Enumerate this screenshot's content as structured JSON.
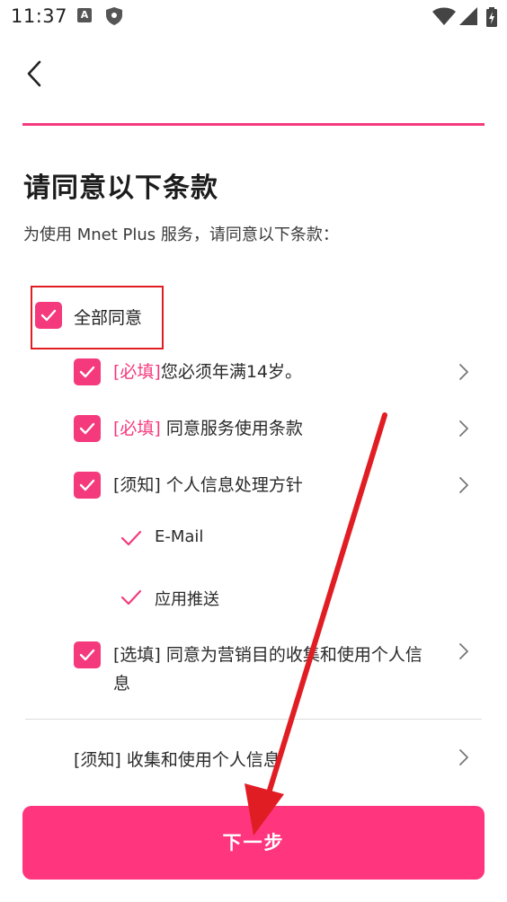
{
  "status_bar": {
    "time": "11:37",
    "a_badge": "A"
  },
  "header": {
    "title": "请同意以下条款",
    "subtitle": "为使用 Mnet Plus 服务，请同意以下条款："
  },
  "agree_all": {
    "label": "全部同意",
    "checked": true
  },
  "items": [
    {
      "tag": "[必填]",
      "text": "您必须年满14岁。",
      "required": true,
      "checked": true
    },
    {
      "tag": "[必填]",
      "text": " 同意服务使用条款",
      "required": true,
      "checked": true
    },
    {
      "tag": "[须知]",
      "text": " 个人信息处理方针",
      "required": false,
      "checked": true
    },
    {
      "tag": "[选填]",
      "text": " 同意为营销目的收集和使用个人信息",
      "required": false,
      "checked": true
    }
  ],
  "sub_items": [
    {
      "label": "E-Mail",
      "checked": true
    },
    {
      "label": "应用推送",
      "checked": true
    }
  ],
  "notice": {
    "label": "[须知] 收集和使用个人信息"
  },
  "next_button": {
    "label": "下一步"
  },
  "colors": {
    "accent": "#f43a7d",
    "button": "#ff357e",
    "annotation": "#e11d24"
  }
}
